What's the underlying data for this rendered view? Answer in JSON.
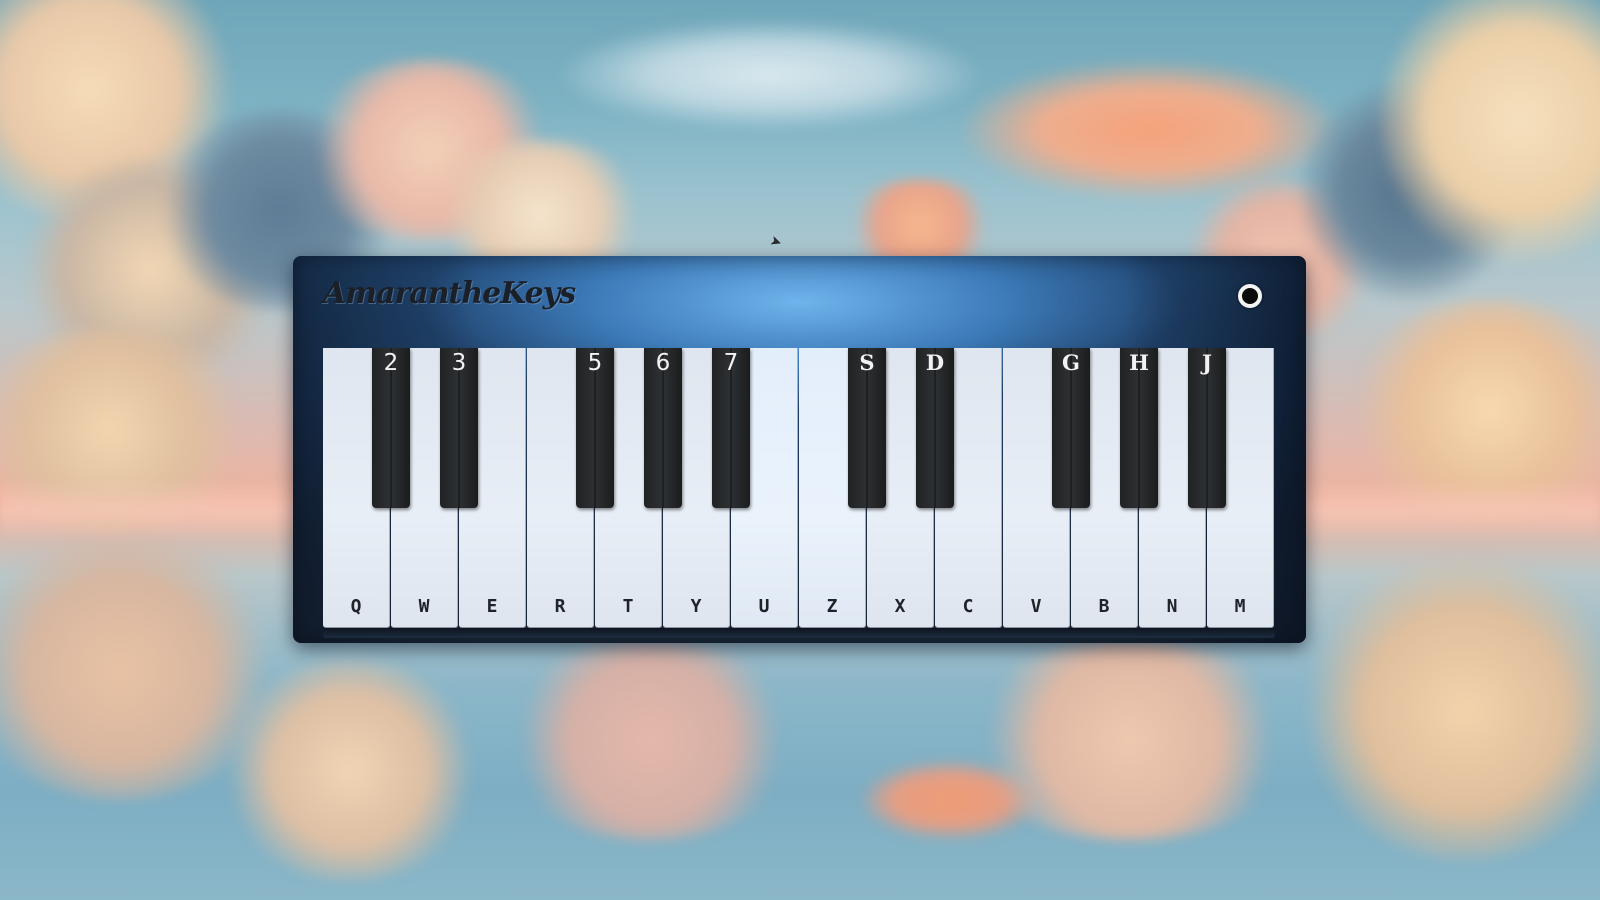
{
  "app": {
    "title": "AmarantheKeys"
  },
  "white_keys": [
    {
      "label": "Q"
    },
    {
      "label": "W"
    },
    {
      "label": "E"
    },
    {
      "label": "R"
    },
    {
      "label": "T"
    },
    {
      "label": "Y"
    },
    {
      "label": "U"
    },
    {
      "label": "Z"
    },
    {
      "label": "X"
    },
    {
      "label": "C"
    },
    {
      "label": "V"
    },
    {
      "label": "B"
    },
    {
      "label": "N"
    },
    {
      "label": "M"
    }
  ],
  "black_keys": [
    {
      "label": "2"
    },
    {
      "label": "3"
    },
    {
      "label": "5"
    },
    {
      "label": "6"
    },
    {
      "label": "7"
    },
    {
      "label": "S"
    },
    {
      "label": "D"
    },
    {
      "label": "G"
    },
    {
      "label": "H"
    },
    {
      "label": "J"
    }
  ],
  "colors": {
    "panel_blue": "#234a77",
    "panel_glow": "#6fb4ec",
    "white_key": "#e8eef6",
    "black_key": "#2e3133"
  },
  "icons": {
    "power": "power-toggle-icon",
    "bird": "bird-icon"
  }
}
